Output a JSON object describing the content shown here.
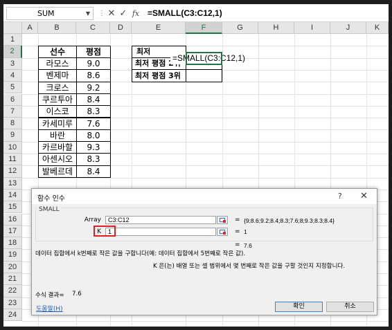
{
  "formula_bar": {
    "name_box": "SUM",
    "cancel_symbol": "✕",
    "enter_symbol": "✓",
    "fx_symbol": "fx",
    "formula": "=SMALL(C3:C12,1)"
  },
  "columns": [
    "A",
    "B",
    "C",
    "D",
    "E",
    "F",
    "G",
    "H",
    "I",
    "J",
    "K"
  ],
  "rows": [
    "1",
    "2",
    "3",
    "4",
    "5",
    "6",
    "7",
    "8",
    "9",
    "10",
    "11",
    "12",
    "13",
    "14",
    "15",
    "16",
    "17",
    "18",
    "19",
    "20",
    "21",
    "22",
    "23",
    "24"
  ],
  "selected_column": "F",
  "selected_row": "2",
  "table": {
    "header_player": "선수",
    "header_rating": "평점",
    "rows": [
      {
        "player": "라모스",
        "rating": "9.0"
      },
      {
        "player": "벤제마",
        "rating": "8.6"
      },
      {
        "player": "크로스",
        "rating": "9.2"
      },
      {
        "player": "쿠르투아",
        "rating": "8.4"
      },
      {
        "player": "이스코",
        "rating": "8.3"
      },
      {
        "player": "카세미루",
        "rating": "7.6"
      },
      {
        "player": "바란",
        "rating": "8.0"
      },
      {
        "player": "카르바할",
        "rating": "9.3"
      },
      {
        "player": "아센시오",
        "rating": "8.3"
      },
      {
        "player": "발베르데",
        "rating": "8.4"
      }
    ]
  },
  "side": {
    "label1": "최저",
    "label2": "최저 평점 2위",
    "label3": "최저 평점 3위",
    "edit_text": "=SMALL(C3:C12,1)"
  },
  "dialog": {
    "title": "함수 인수",
    "help_symbol": "?",
    "close_symbol": "✕",
    "function_name": "SMALL",
    "array_label": "Array",
    "array_value": "C3:C12",
    "array_result": "{9;8.6;9.2;8.4;8.3;7.6;8;9.3;8.3;8.4}",
    "k_label": "K",
    "k_value": "1",
    "k_result": "1",
    "eq": "=",
    "overall_result": "7.6",
    "description": "데이터 집합에서 k번째로 작은 값을 구합니다(예: 데이터 집합에서 5번째로 작은 값).",
    "arg_description": "K 은(는) 배열 또는 셀 범위에서 몇 번째로 작은 값을 구할 것인지 지정합니다.",
    "formula_result_label": "수식 결과=",
    "formula_result_value": "7.6",
    "help_link": "도움말(H)",
    "ok_label": "확인",
    "cancel_label": "취소"
  }
}
